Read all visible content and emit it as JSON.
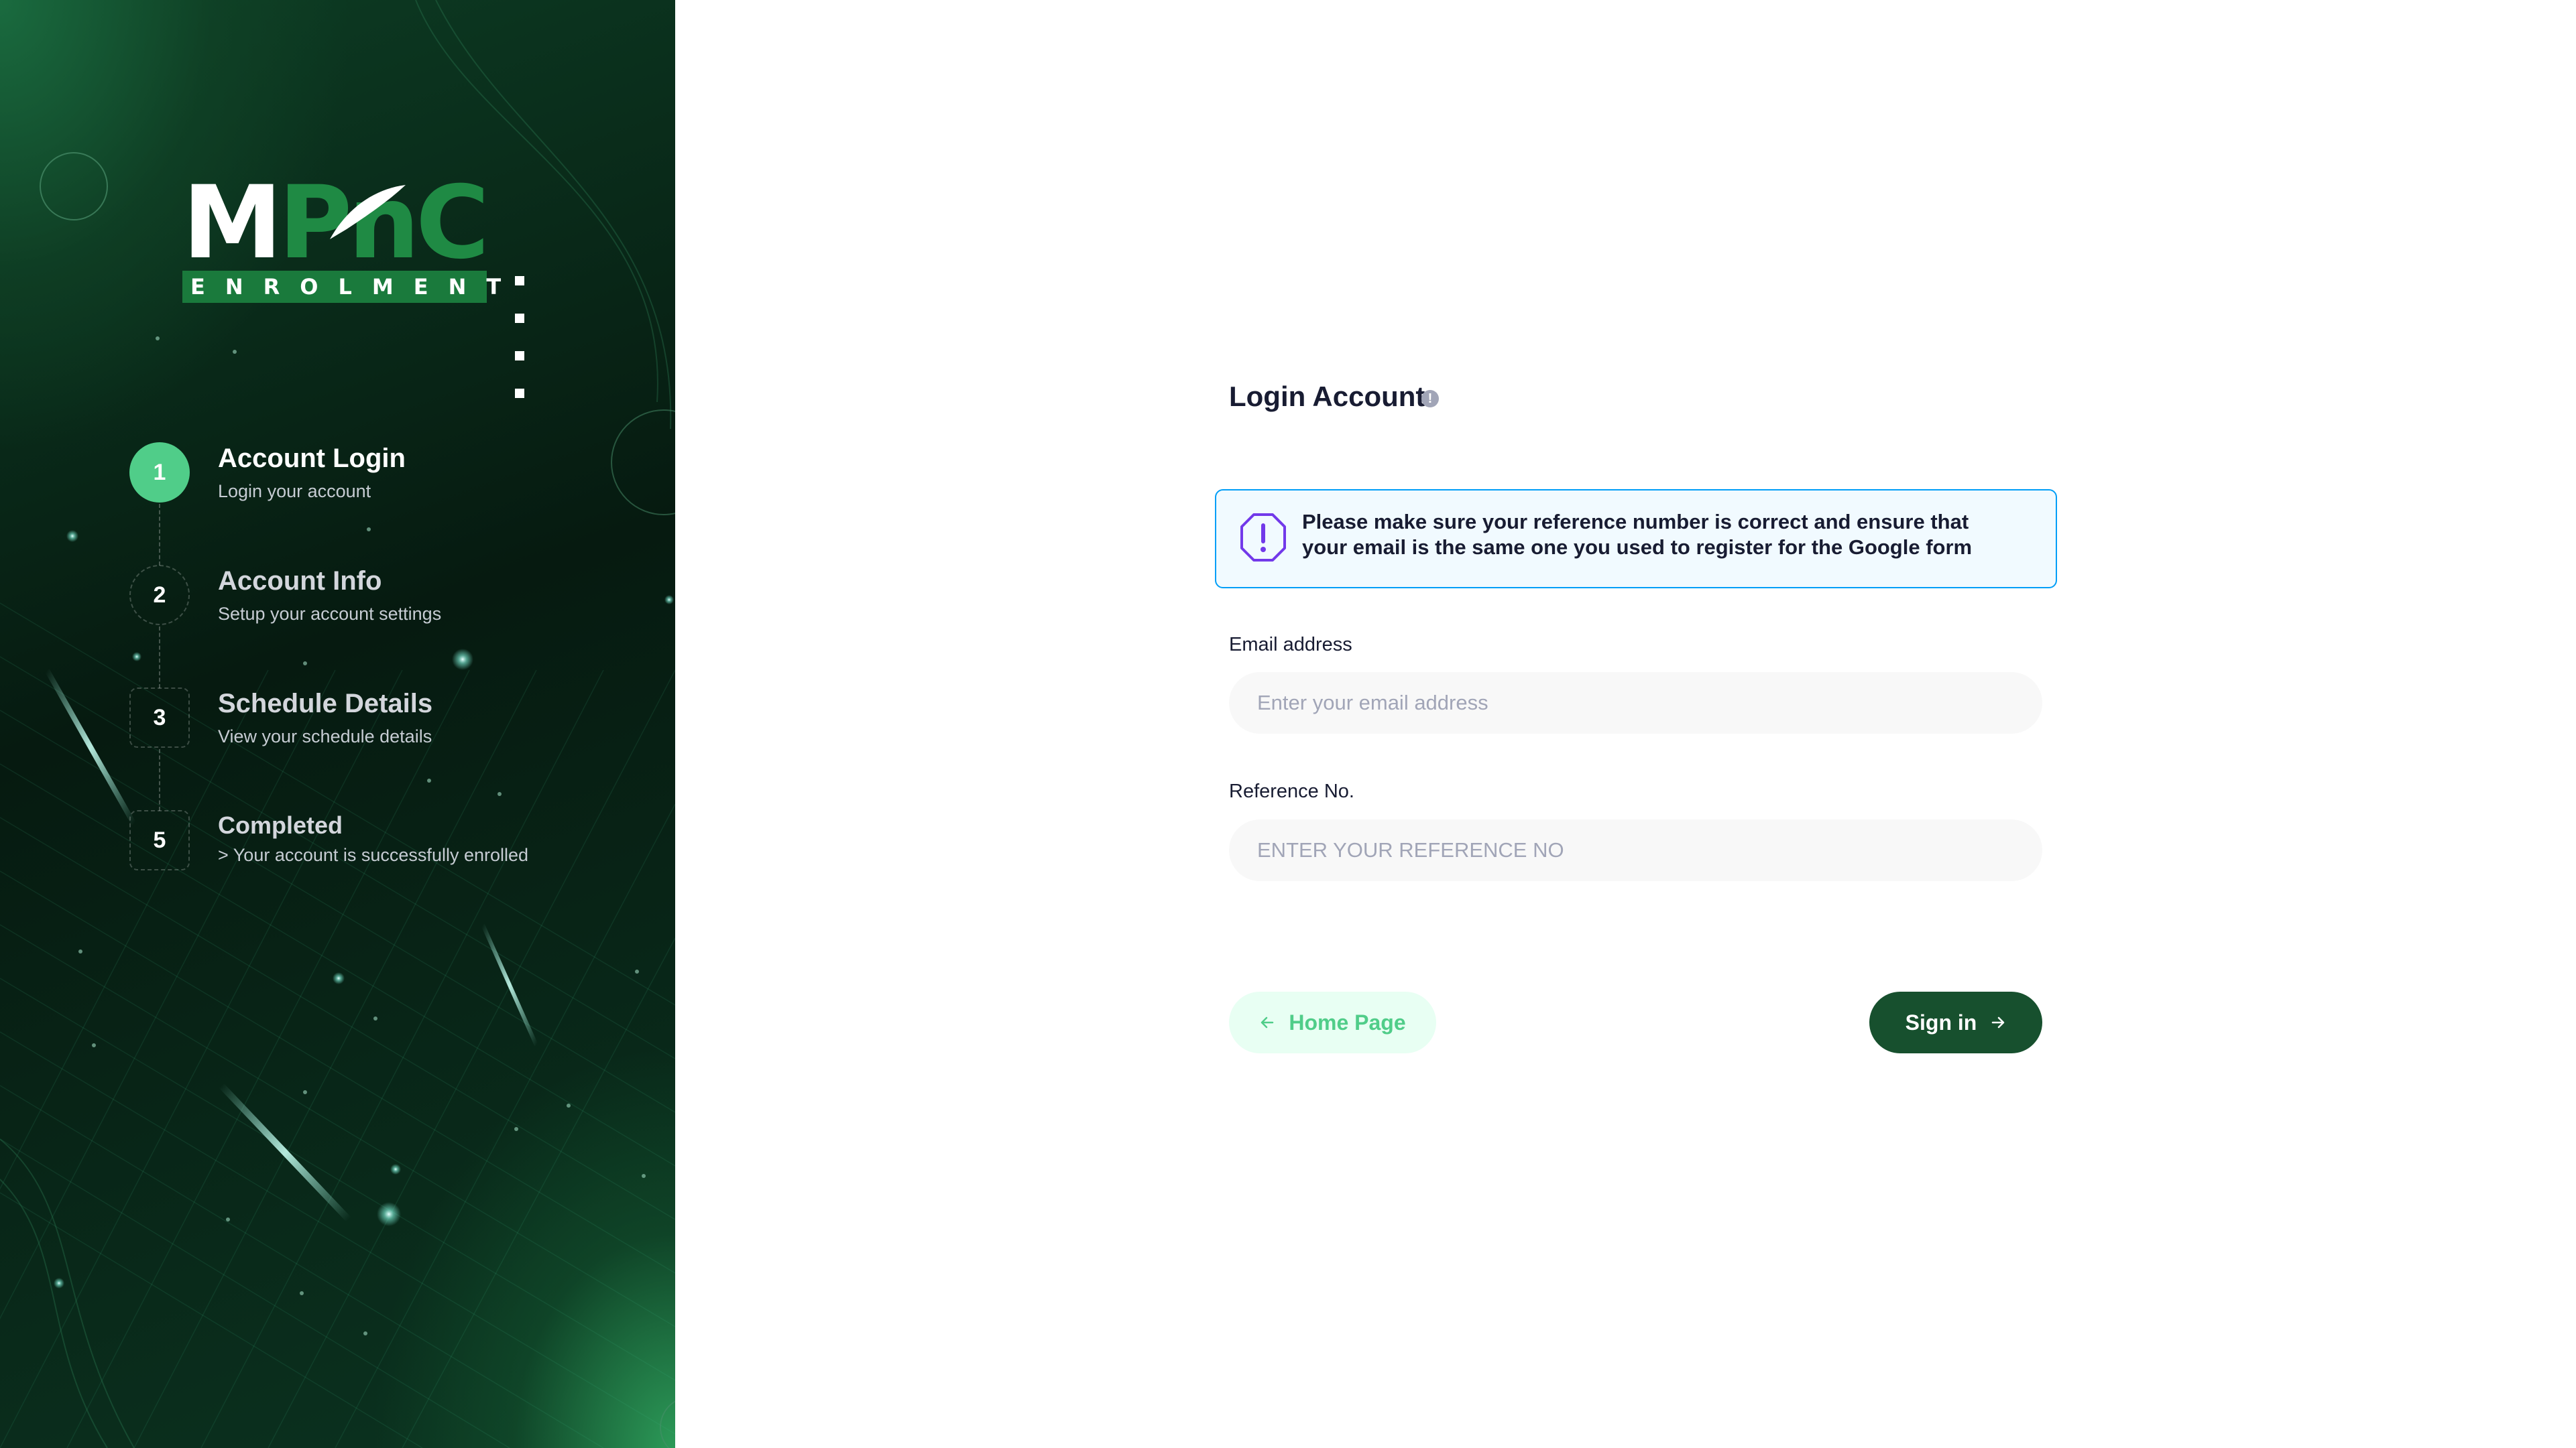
{
  "sidebar": {
    "logo": {
      "wordmark": "MPnC",
      "tagline": "ENROLMENT"
    },
    "steps": [
      {
        "number": "1",
        "title": "Account Login",
        "description": "Login your account",
        "active": true
      },
      {
        "number": "2",
        "title": "Account Info",
        "description": "Setup your account settings",
        "active": false
      },
      {
        "number": "3",
        "title": "Schedule Details",
        "description": "View your schedule details",
        "active": false
      },
      {
        "number": "5",
        "title": "Completed",
        "description": "> Your account is successfully enrolled",
        "active": false
      }
    ]
  },
  "form": {
    "title": "Login Account",
    "notice": "Please make sure your reference number is correct and ensure that your email is the same one you used to register for the Google form",
    "email": {
      "label": "Email address",
      "placeholder": "Enter your email address",
      "value": ""
    },
    "reference": {
      "label": "Reference No.",
      "placeholder": "ENTER YOUR REFERENCE NO",
      "value": ""
    },
    "home_button": "Home Page",
    "signin_button": "Sign in"
  },
  "colors": {
    "brand_dark_green": "#17502e",
    "accent_green": "#50cd89",
    "notice_border": "#009ef7",
    "notice_icon": "#7239ea"
  },
  "icons": [
    "info-icon",
    "warning-octagon-icon",
    "arrow-left-icon",
    "arrow-right-icon"
  ]
}
